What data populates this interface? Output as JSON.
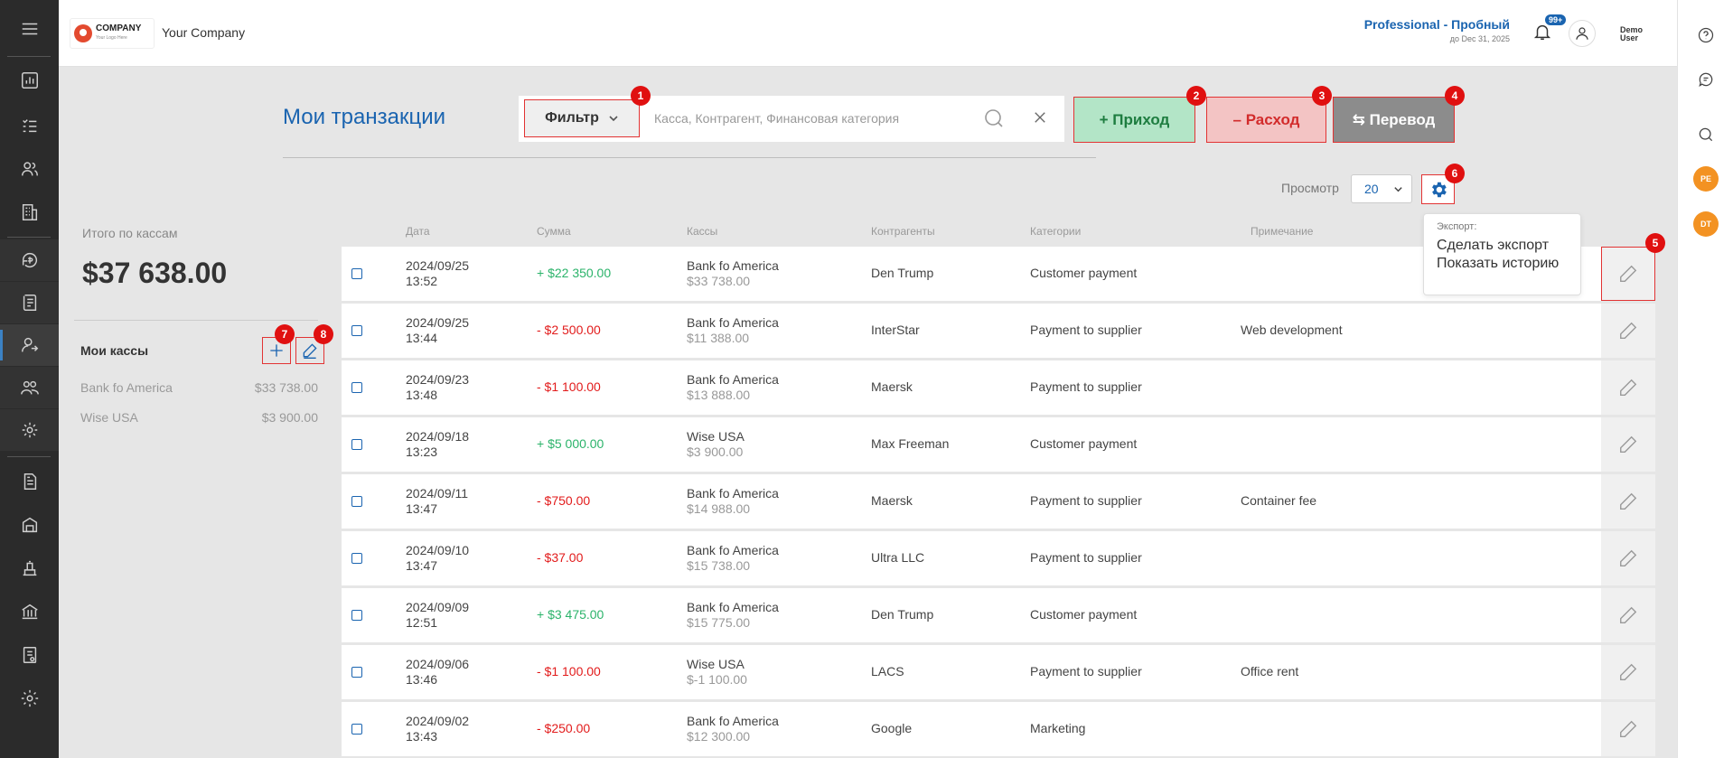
{
  "header": {
    "logo_text": "COMPANY",
    "logo_sub": "Your Logo Here",
    "company_name": "Your Company",
    "plan_title": "Professional - Пробный",
    "plan_date": "до Dec 31, 2025",
    "notif_badge": "99+",
    "user_line1": "Demo",
    "user_line2": "User"
  },
  "page": {
    "title": "Мои транзакции",
    "filter_label": "Фильтр",
    "search_placeholder": "Касса, Контрагент, Финансовая категория",
    "btn_income": "+ Приход",
    "btn_expense": "– Расход",
    "btn_transfer": "⇆ Перевод",
    "view_label": "Просмотр",
    "view_value": "20"
  },
  "markers": [
    "1",
    "2",
    "3",
    "4",
    "5",
    "6",
    "7",
    "8"
  ],
  "export_menu": {
    "title": "Экспорт:",
    "items": [
      "Сделать экспорт",
      "Показать историю"
    ]
  },
  "summary": {
    "label": "Итого по кассам",
    "total": "$37 638.00",
    "kassy_title": "Мои кассы",
    "kassy": [
      {
        "name": "Bank fo America",
        "amount": "$33 738.00"
      },
      {
        "name": "Wise USA",
        "amount": "$3 900.00"
      }
    ]
  },
  "table": {
    "headers": [
      "Дата",
      "Сумма",
      "Кассы",
      "Контрагенты",
      "Категории",
      "Примечание"
    ],
    "rows": [
      {
        "date": "2024/09/25",
        "time": "13:52",
        "amount": "+ $22 350.00",
        "sign": "pos",
        "account": "Bank fo America",
        "balance": "$33 738.00",
        "counterparty": "Den Trump",
        "category": "Customer payment",
        "note": ""
      },
      {
        "date": "2024/09/25",
        "time": "13:44",
        "amount": "- $2 500.00",
        "sign": "neg",
        "account": "Bank fo America",
        "balance": "$11 388.00",
        "counterparty": "InterStar",
        "category": "Payment to supplier",
        "note": "Web development"
      },
      {
        "date": "2024/09/23",
        "time": "13:48",
        "amount": "- $1 100.00",
        "sign": "neg",
        "account": "Bank fo America",
        "balance": "$13 888.00",
        "counterparty": "Maersk",
        "category": "Payment to supplier",
        "note": ""
      },
      {
        "date": "2024/09/18",
        "time": "13:23",
        "amount": "+ $5 000.00",
        "sign": "pos",
        "account": "Wise USA",
        "balance": "$3 900.00",
        "counterparty": "Max Freeman",
        "category": "Customer payment",
        "note": ""
      },
      {
        "date": "2024/09/11",
        "time": "13:47",
        "amount": "- $750.00",
        "sign": "neg",
        "account": "Bank fo America",
        "balance": "$14 988.00",
        "counterparty": "Maersk",
        "category": "Payment to supplier",
        "note": "Container fee"
      },
      {
        "date": "2024/09/10",
        "time": "13:47",
        "amount": "- $37.00",
        "sign": "neg",
        "account": "Bank fo America",
        "balance": "$15 738.00",
        "counterparty": "Ultra LLC",
        "category": "Payment to supplier",
        "note": ""
      },
      {
        "date": "2024/09/09",
        "time": "12:51",
        "amount": "+ $3 475.00",
        "sign": "pos",
        "account": "Bank fo America",
        "balance": "$15 775.00",
        "counterparty": "Den Trump",
        "category": "Customer payment",
        "note": ""
      },
      {
        "date": "2024/09/06",
        "time": "13:46",
        "amount": "- $1 100.00",
        "sign": "neg",
        "account": "Wise USA",
        "balance": "$-1 100.00",
        "counterparty": "LACS",
        "category": "Payment to supplier",
        "note": "Office rent"
      },
      {
        "date": "2024/09/02",
        "time": "13:43",
        "amount": "- $250.00",
        "sign": "neg",
        "account": "Bank fo America",
        "balance": "$12 300.00",
        "counterparty": "Google",
        "category": "Marketing",
        "note": ""
      }
    ]
  },
  "right_bar": {
    "avatars": [
      "PE",
      "DT"
    ]
  },
  "colors": {
    "accent": "#1a64b0",
    "positive": "#2bb36a",
    "negative": "#e21b1b",
    "marker": "#e01010"
  }
}
